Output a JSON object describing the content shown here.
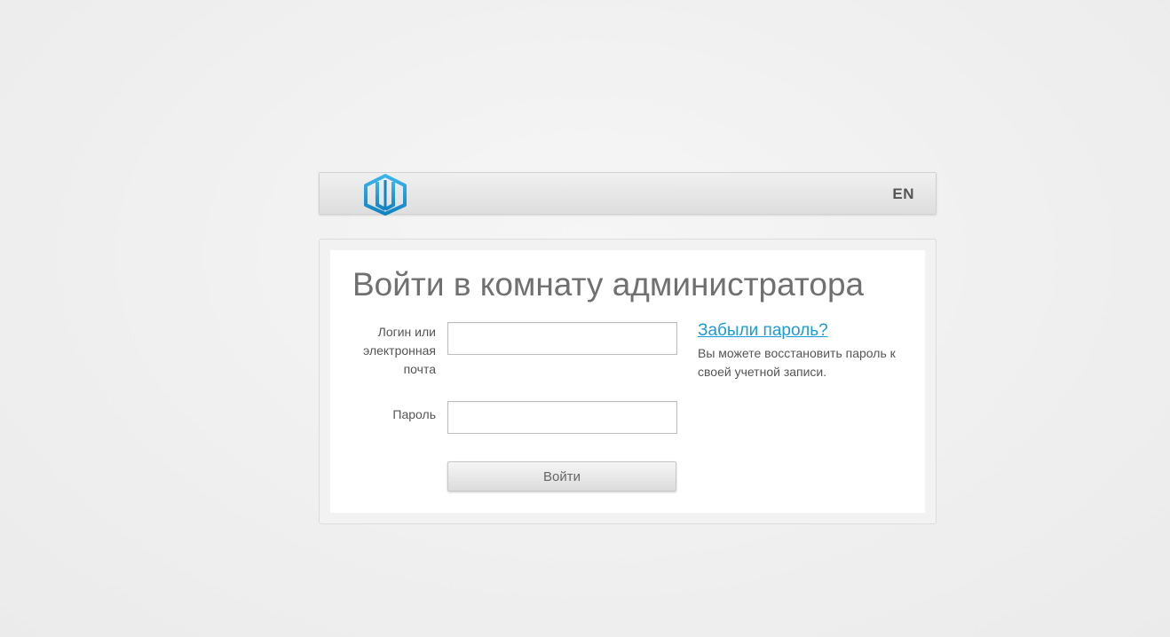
{
  "header": {
    "logo_icon": "brand-logo-icon",
    "logo_color": "#1a9cd8",
    "language_toggle": "EN"
  },
  "login_card": {
    "title": "Войти в комнату администратора",
    "login_label": "Логин или электронная почта",
    "login_value": "",
    "login_placeholder": "",
    "password_label": "Пароль",
    "password_value": "",
    "password_placeholder": "",
    "submit_label": "Войти"
  },
  "recovery": {
    "link_label": "Забыли пароль?",
    "link_color": "#1a9cd8",
    "description": "Вы можете восстановить пароль к своей учетной записи."
  }
}
